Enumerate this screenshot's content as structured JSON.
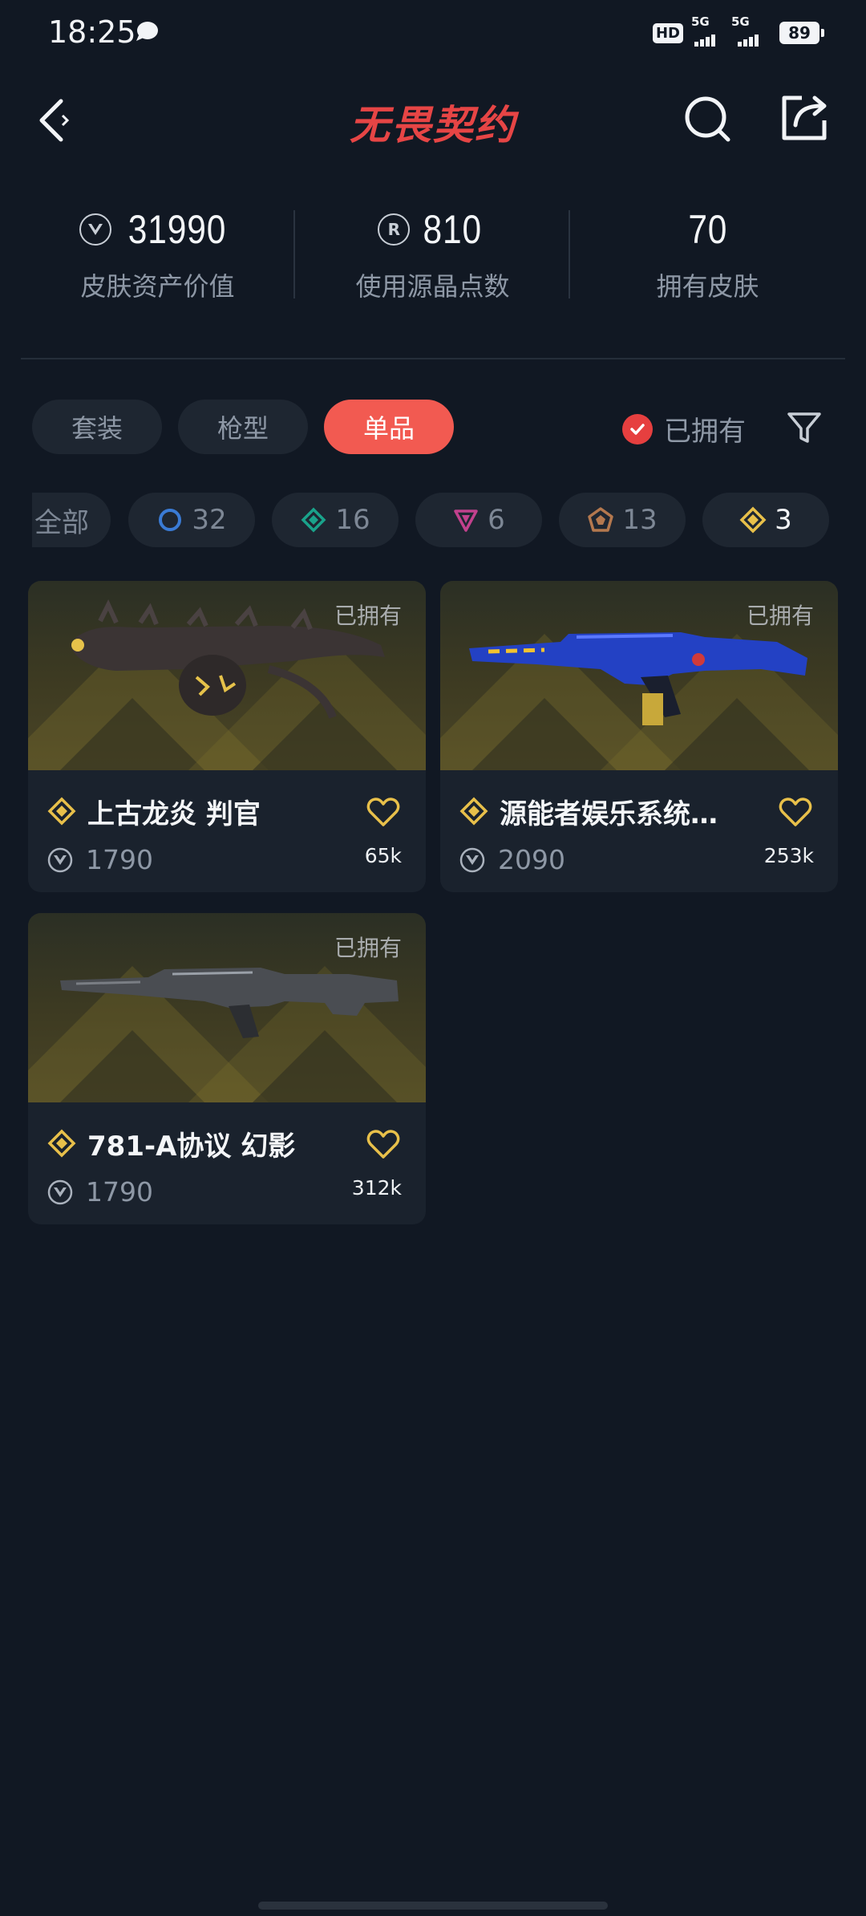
{
  "status_bar": {
    "time": "18:25",
    "network": "HD",
    "signal_1": "5G",
    "signal_2": "5G",
    "battery": "89",
    "icons": [
      "chat-bubble-icon",
      "hd-icon",
      "signal-icon",
      "battery-icon"
    ]
  },
  "header": {
    "logo": "无畏契约",
    "icons": [
      "back-icon",
      "search-icon",
      "share-icon"
    ]
  },
  "stats": [
    {
      "value": "31990",
      "label": "皮肤资产价值",
      "icon": "vp-icon"
    },
    {
      "value": "810",
      "label": "使用源晶点数",
      "icon": "radianite-icon"
    },
    {
      "value": "70",
      "label": "拥有皮肤"
    }
  ],
  "tabs": [
    {
      "label": "套装",
      "active": false
    },
    {
      "label": "枪型",
      "active": false
    },
    {
      "label": "单品",
      "active": true
    }
  ],
  "owned_filter": {
    "label": "已拥有",
    "checked": true
  },
  "rarity_chips": [
    {
      "label": "全部",
      "icon": ""
    },
    {
      "label": "32",
      "icon": "select-tier-icon",
      "color": "#3a7bd5"
    },
    {
      "label": "16",
      "icon": "deluxe-tier-icon",
      "color": "#1aa38b"
    },
    {
      "label": "6",
      "icon": "premium-tier-icon",
      "color": "#c2418d"
    },
    {
      "label": "13",
      "icon": "ultra-tier-icon",
      "color": "#b4784e"
    },
    {
      "label": "3",
      "icon": "exclusive-tier-icon",
      "color": "#e8c04a",
      "selected": true
    }
  ],
  "cards": [
    {
      "owned_tag": "已拥有",
      "title": "上古龙炎 判官",
      "price": "1790",
      "likes": "65k"
    },
    {
      "owned_tag": "已拥有",
      "title": "源能者娱乐系统…",
      "price": "2090",
      "likes": "253k"
    },
    {
      "owned_tag": "已拥有",
      "title": "781-A协议 幻影",
      "price": "1790",
      "likes": "312k"
    }
  ],
  "colors": {
    "background": "#111823",
    "accent": "#f25a51",
    "tier_gold": "#e8c04a"
  }
}
